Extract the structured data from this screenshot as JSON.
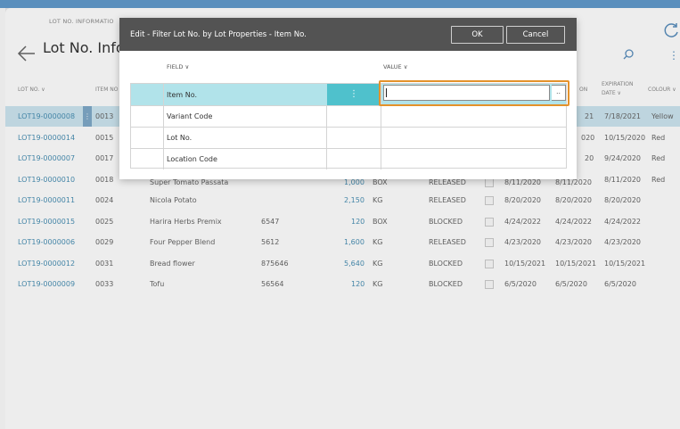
{
  "page": {
    "caption": "LOT NO. INFORMATIO",
    "title": "Lot No. Info"
  },
  "list": {
    "columns": [
      "LOT NO. ∨",
      "ITEM NO",
      "ON",
      "EXPIRATION",
      "DATE ∨",
      "COLOUR ∨"
    ],
    "rows": [
      {
        "lot": "LOT19-0000008",
        "item": "0013",
        "expiration": "7/18/2021",
        "colour": "Yellow",
        "partial": "21"
      },
      {
        "lot": "LOT19-0000014",
        "item": "0015",
        "expiration": "10/15/2020",
        "colour": "Red",
        "partial": "020"
      },
      {
        "lot": "LOT19-0000007",
        "item": "0017",
        "expiration": "9/24/2020",
        "colour": "Red",
        "partial": "20"
      },
      {
        "lot": "LOT19-0000010",
        "item": "0018",
        "desc": "Super Tomato Passata",
        "qty": "1,000",
        "uom": "BOX",
        "status": "RELEASED",
        "d1": "8/11/2020",
        "d2": "8/11/2020",
        "expiration": "8/11/2020",
        "colour": "Red"
      },
      {
        "lot": "LOT19-0000011",
        "item": "0024",
        "desc": "Nicola Potato",
        "vendor": "",
        "qty": "2,150",
        "uom": "KG",
        "status": "RELEASED",
        "d1": "8/20/2020",
        "d2": "8/20/2020",
        "expiration": "8/20/2020",
        "colour": ""
      },
      {
        "lot": "LOT19-0000015",
        "item": "0025",
        "desc": "Harira Herbs Premix",
        "vendor": "6547",
        "qty": "120",
        "uom": "BOX",
        "status": "BLOCKED",
        "d1": "4/24/2022",
        "d2": "4/24/2022",
        "expiration": "4/24/2022",
        "colour": ""
      },
      {
        "lot": "LOT19-0000006",
        "item": "0029",
        "desc": "Four Pepper Blend",
        "vendor": "5612",
        "qty": "1,600",
        "uom": "KG",
        "status": "RELEASED",
        "d1": "4/23/2020",
        "d2": "4/23/2020",
        "expiration": "4/23/2020",
        "colour": ""
      },
      {
        "lot": "LOT19-0000012",
        "item": "0031",
        "desc": "Bread flower",
        "vendor": "875646",
        "qty": "5,640",
        "uom": "KG",
        "status": "BLOCKED",
        "d1": "10/15/2021",
        "d2": "10/15/2021",
        "expiration": "10/15/2021",
        "colour": ""
      },
      {
        "lot": "LOT19-0000009",
        "item": "0033",
        "desc": "Tofu",
        "vendor": "56564",
        "qty": "120",
        "uom": "KG",
        "status": "BLOCKED",
        "d1": "6/5/2020",
        "d2": "6/5/2020",
        "expiration": "6/5/2020",
        "colour": ""
      }
    ]
  },
  "dialog": {
    "title": "Edit - Filter Lot No. by Lot Properties - Item No.",
    "ok_label": "OK",
    "cancel_label": "Cancel",
    "field_header": "FIELD ∨",
    "value_header": "VALUE ∨",
    "rows": [
      {
        "field": "Item No.",
        "value": ""
      },
      {
        "field": "Variant Code",
        "value": ""
      },
      {
        "field": "Lot No.",
        "value": ""
      },
      {
        "field": "Location Code",
        "value": ""
      }
    ],
    "dots_label": "⋮",
    "lookup_label": ".."
  },
  "colors": {
    "accent": "#5a8fbd",
    "highlight": "#e4922b",
    "selected_row": "#b1e3ea"
  }
}
